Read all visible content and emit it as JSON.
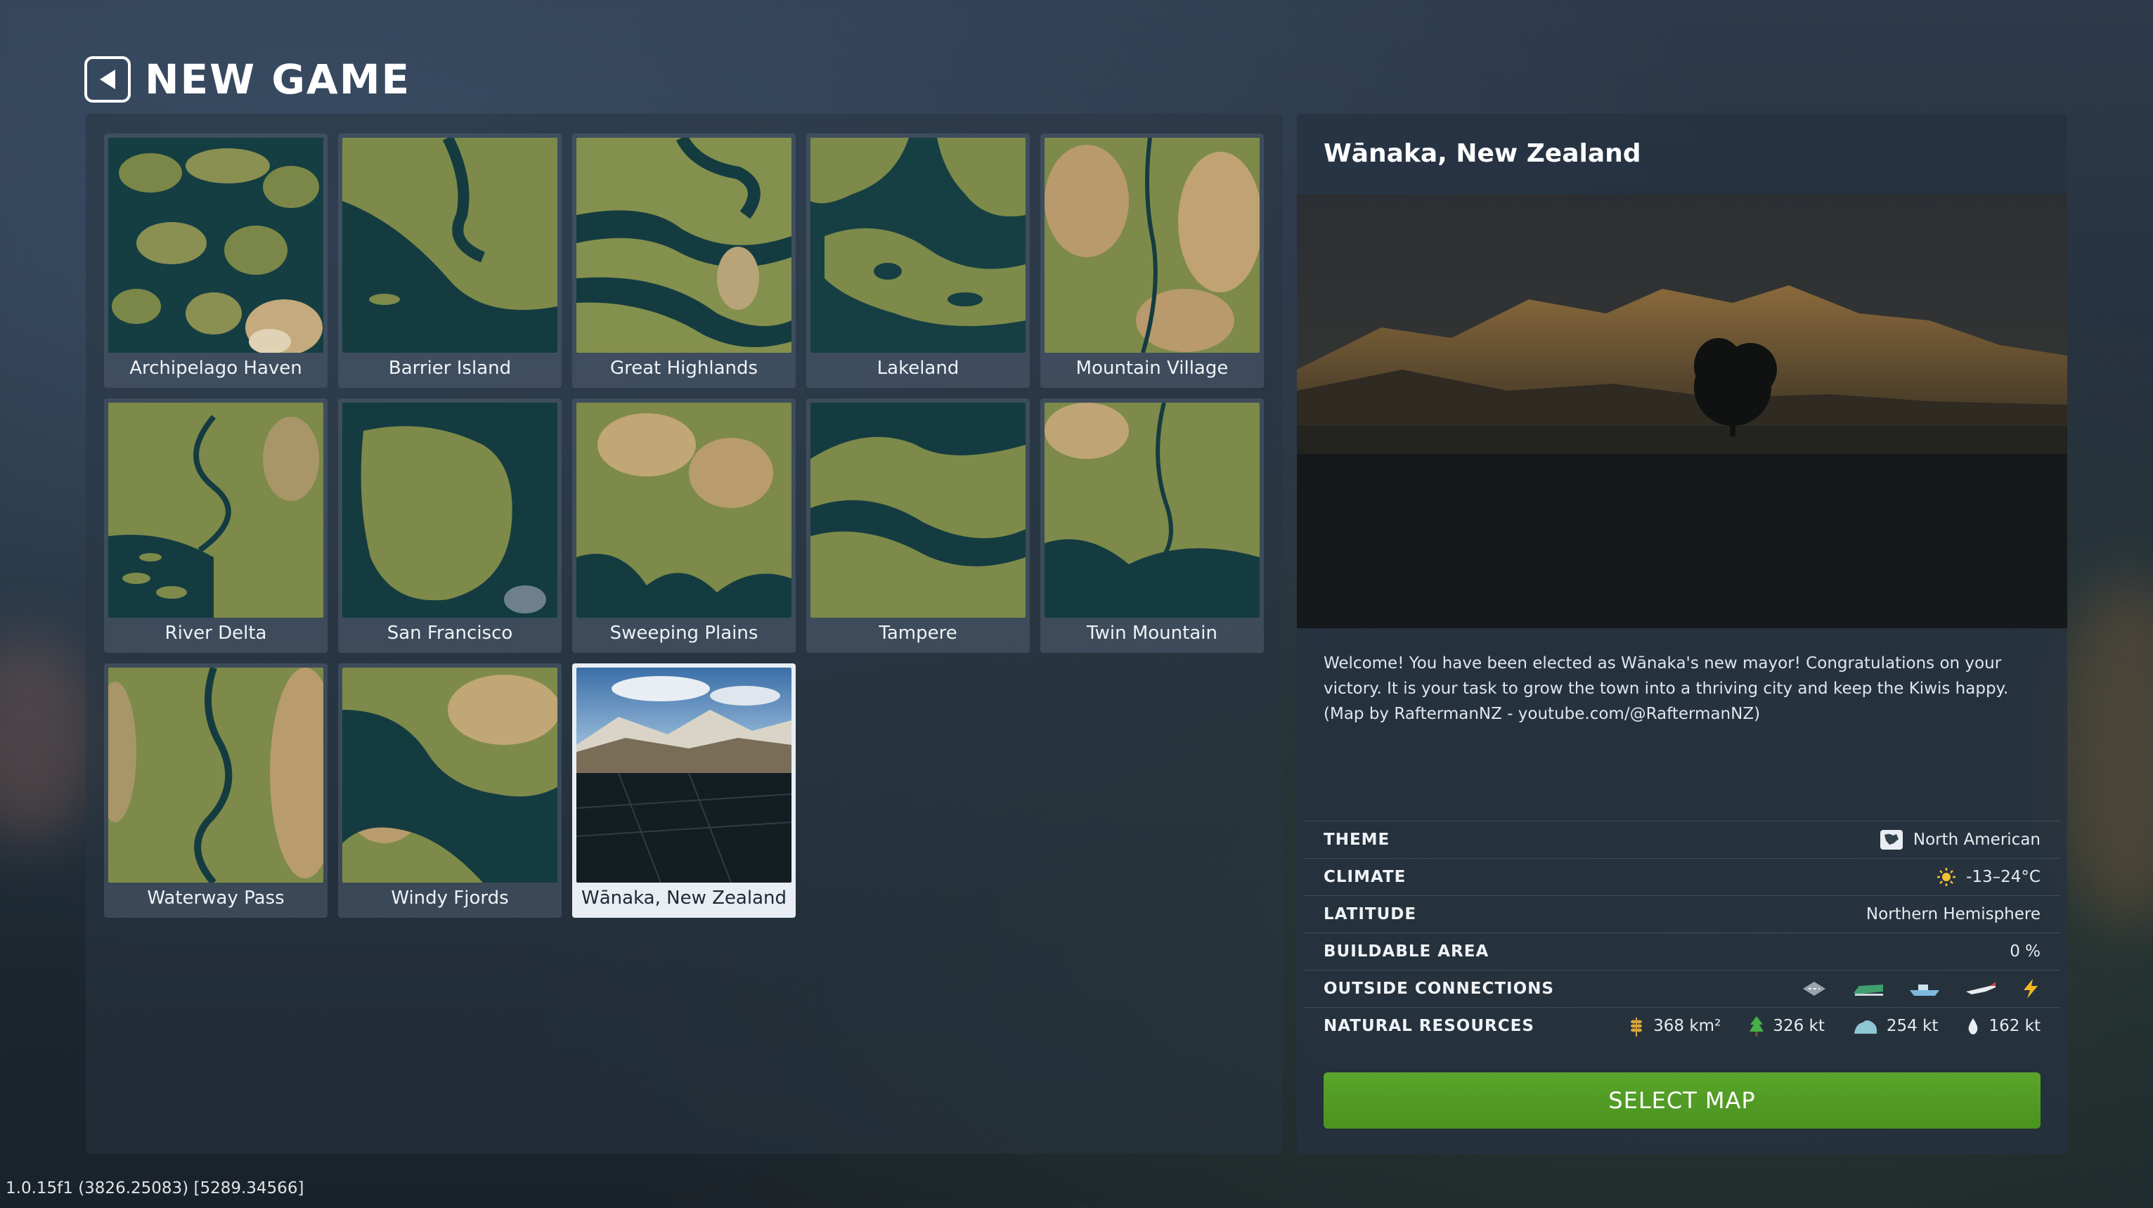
{
  "header": {
    "title": "NEW GAME"
  },
  "maps": [
    {
      "label": "Archipelago Haven"
    },
    {
      "label": "Barrier Island"
    },
    {
      "label": "Great Highlands"
    },
    {
      "label": "Lakeland"
    },
    {
      "label": "Mountain Village"
    },
    {
      "label": "River Delta"
    },
    {
      "label": "San Francisco"
    },
    {
      "label": "Sweeping Plains"
    },
    {
      "label": "Tampere"
    },
    {
      "label": "Twin Mountain"
    },
    {
      "label": "Waterway Pass"
    },
    {
      "label": "Windy Fjords"
    },
    {
      "label": "Wānaka, New Zealand",
      "selected": true
    }
  ],
  "detail": {
    "title": "Wānaka, New Zealand",
    "description": "Welcome! You have been elected as Wānaka's new mayor! Congratulations on your victory. It is your task to grow the town into a thriving city and keep the Kiwis happy. (Map by RaftermanNZ - youtube.com/@RaftermanNZ)",
    "stats": {
      "theme": {
        "label": "THEME",
        "value": "North American",
        "icon": "north-american-theme-icon"
      },
      "climate": {
        "label": "CLIMATE",
        "value": "-13–24°C",
        "icon": "sun-icon"
      },
      "latitude": {
        "label": "LATITUDE",
        "value": "Northern Hemisphere"
      },
      "buildable": {
        "label": "BUILDABLE AREA",
        "value": "0 %"
      },
      "connections": {
        "label": "OUTSIDE CONNECTIONS",
        "icons": [
          "road-icon",
          "train-icon",
          "ship-icon",
          "airplane-icon",
          "electricity-icon"
        ]
      },
      "resources": {
        "label": "NATURAL RESOURCES",
        "items": [
          {
            "icon": "fertile-land-icon",
            "value": "368 km²"
          },
          {
            "icon": "forest-icon",
            "value": "326 kt"
          },
          {
            "icon": "ore-icon",
            "value": "254 kt"
          },
          {
            "icon": "oil-icon",
            "value": "162 kt"
          }
        ]
      }
    },
    "select_label": "SELECT MAP"
  },
  "version": "1.0.15f1 (3826.25083) [5289.34566]",
  "colors": {
    "accent_green": "#5aa52b",
    "water": "#123b3f",
    "land": "#7d8a4a"
  }
}
